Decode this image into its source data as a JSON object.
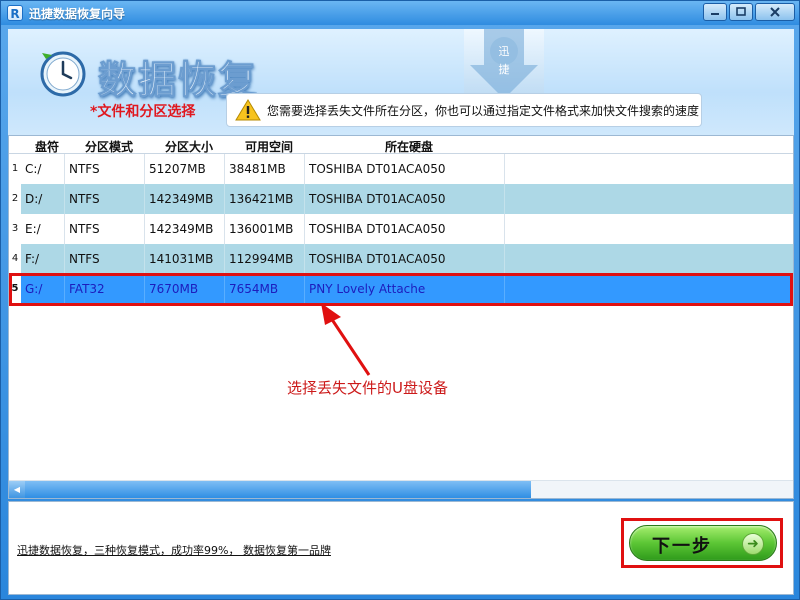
{
  "window": {
    "title": "迅捷数据恢复向导",
    "app_icon_letter": "R"
  },
  "header": {
    "banner_title": "数据恢复",
    "logo_text": "迅捷",
    "step_label": "*文件和分区选择",
    "tip_text": "您需要选择丢失文件所在分区，你也可以通过指定文件格式来加快文件搜索的速度"
  },
  "table": {
    "columns": [
      "盘符",
      "分区模式",
      "分区大小",
      "可用空间",
      "所在硬盘"
    ],
    "rows": [
      {
        "index": "1",
        "drive": "C:/",
        "fs": "NTFS",
        "size": "51207MB",
        "free": "38481MB",
        "disk": "TOSHIBA DT01ACA050"
      },
      {
        "index": "2",
        "drive": "D:/",
        "fs": "NTFS",
        "size": "142349MB",
        "free": "136421MB",
        "disk": "TOSHIBA DT01ACA050"
      },
      {
        "index": "3",
        "drive": "E:/",
        "fs": "NTFS",
        "size": "142349MB",
        "free": "136001MB",
        "disk": "TOSHIBA DT01ACA050"
      },
      {
        "index": "4",
        "drive": "F:/",
        "fs": "NTFS",
        "size": "141031MB",
        "free": "112994MB",
        "disk": "TOSHIBA DT01ACA050"
      },
      {
        "index": "5",
        "drive": "G:/",
        "fs": "FAT32",
        "size": "7670MB",
        "free": "7654MB",
        "disk": "PNY Lovely Attache"
      }
    ],
    "selected_index": "5"
  },
  "annotation": {
    "text": "选择丢失文件的U盘设备"
  },
  "footer": {
    "slogan": "迅捷数据恢复，三种恢复模式，成功率99%， 数据恢复第一品牌",
    "next_label": "下一步"
  },
  "colors": {
    "selected_row": "#3399ff",
    "alt_row": "#add8e6",
    "highlight": "#e01010",
    "step_label": "#e0181f"
  },
  "icons": [
    "app-icon",
    "minimize-icon",
    "maximize-icon",
    "close-icon",
    "clock-icon",
    "warning-icon",
    "arrow-right-icon",
    "scroll-left-icon"
  ]
}
